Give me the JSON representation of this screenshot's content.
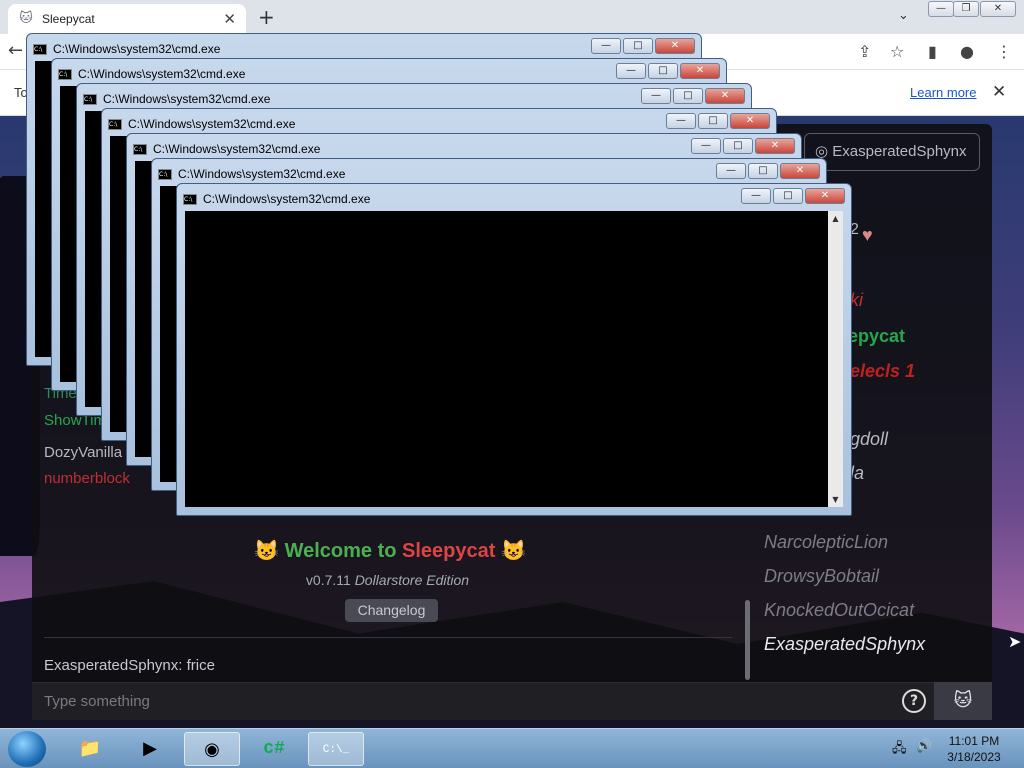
{
  "browser": {
    "tab_title": "Sleepycat",
    "infobar_lead": "To",
    "infobar_link": "Learn more"
  },
  "chat": {
    "user_chip": "ExasperatedSphynx",
    "lines": [
      {
        "text": "Time",
        "color": "#2e8b57"
      },
      {
        "text": "ShowTim",
        "color": "#27a74b"
      },
      {
        "text": "DozyVanilla",
        "color": "#b8b8c2"
      },
      {
        "text": "numberblock",
        "color": "#c03030"
      }
    ],
    "partial_right": [
      {
        "text": "2",
        "color": "#b8b8c2"
      },
      {
        "text": "ki",
        "color": "#c03030"
      },
      {
        "text": "epycat",
        "color": "#27a74b"
      },
      {
        "text": "elecls 1",
        "color": "#c02020"
      },
      {
        "text": "gdoll",
        "color": "#b8b8c2"
      },
      {
        "text": "la",
        "color": "#b8b8c2"
      }
    ],
    "sidebar_names": [
      "NarcolepticLion",
      "DrowsyBobtail",
      "KnockedOutOcicat",
      "ExasperatedSphynx"
    ],
    "welcome_prefix": "Welcome to ",
    "welcome_brand": "Sleepycat",
    "version": "v0.7.11",
    "edition": "Dollarstore Edition",
    "changelog": "Changelog",
    "last_message": "ExasperatedSphynx: frice",
    "input_placeholder": "Type something",
    "help": "?"
  },
  "cmd_title": "C:\\Windows\\system32\\cmd.exe",
  "taskbar": {
    "time": "11:01 PM",
    "date": "3/18/2023"
  }
}
